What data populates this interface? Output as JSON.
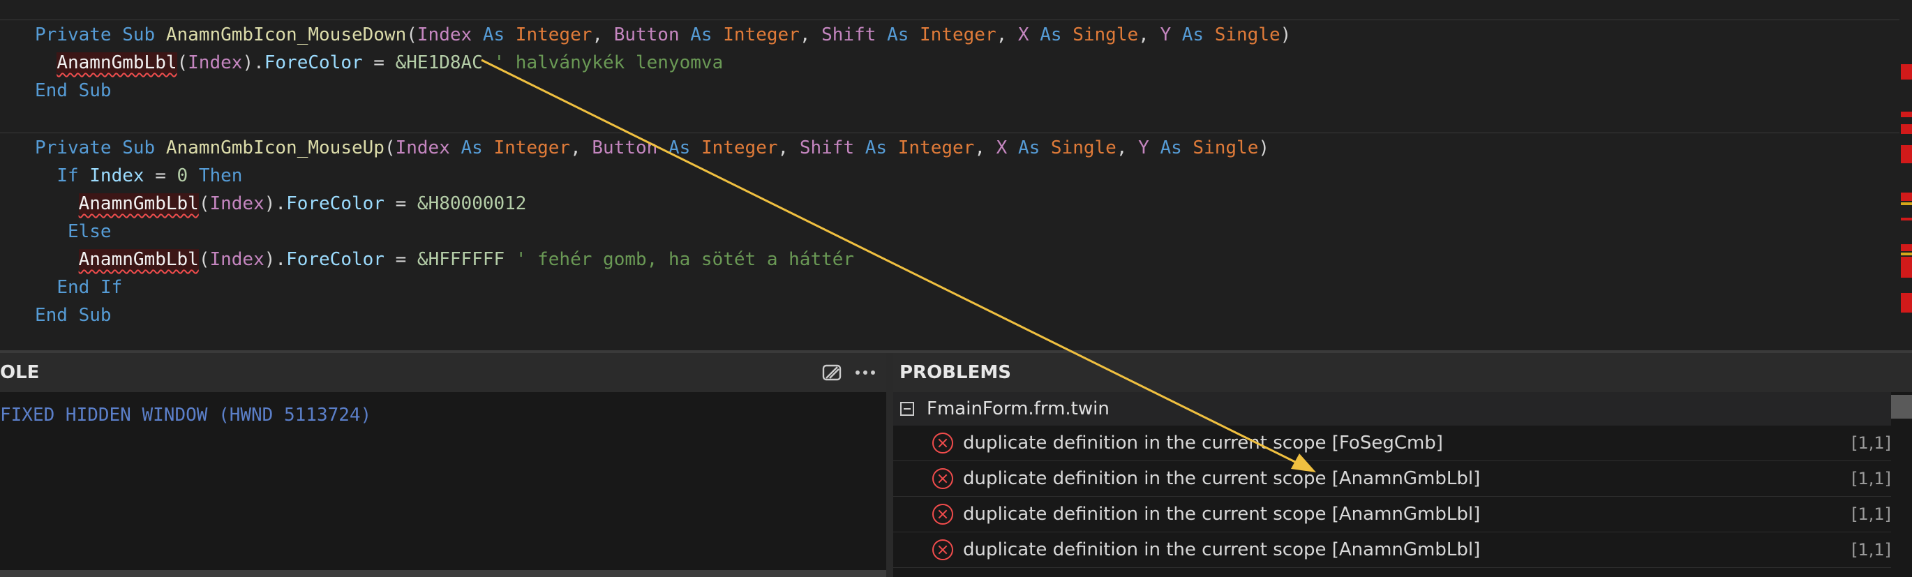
{
  "editor": {
    "sub1": {
      "kw_private": "Private",
      "kw_sub": "Sub",
      "name": "AnamnGmbIcon_MouseDown",
      "p_index": "Index",
      "p_button": "Button",
      "p_shift": "Shift",
      "p_x": "X",
      "p_y": "Y",
      "kw_as": "As",
      "t_integer": "Integer",
      "t_single": "Single",
      "body_obj": "AnamnGmbLbl",
      "body_idx": "Index",
      "body_prop": "ForeColor",
      "body_val": "&HE1D8AC",
      "body_comment": "' halványkék lenyomva",
      "end": "End Sub"
    },
    "sub2": {
      "kw_private": "Private",
      "kw_sub": "Sub",
      "name": "AnamnGmbIcon_MouseUp",
      "p_index": "Index",
      "p_button": "Button",
      "p_shift": "Shift",
      "p_x": "X",
      "p_y": "Y",
      "kw_as": "As",
      "t_integer": "Integer",
      "t_single": "Single",
      "if_kw": "If",
      "if_var": "Index",
      "if_eq": "=",
      "if_zero": "0",
      "then_kw": "Then",
      "obj": "AnamnGmbLbl",
      "idx": "Index",
      "prop": "ForeColor",
      "val1": "&H80000012",
      "else_kw": "Else",
      "val2": "&HFFFFFF",
      "comment2": "' fehér gomb, ha sötét a háttér",
      "end_if": "End If",
      "end": "End Sub"
    }
  },
  "console": {
    "title": "OLE",
    "line": "FIXED HIDDEN WINDOW (HWND 5113724)",
    "icons": [
      "clear-icon",
      "more-icon"
    ]
  },
  "problems": {
    "title": "PROBLEMS",
    "file": "FmainForm.frm.twin",
    "items": [
      {
        "message": "duplicate definition in the current scope [FoSegCmb]",
        "position": "[1,1]"
      },
      {
        "message": "duplicate definition in the current scope [AnamnGmbLbl]",
        "position": "[1,1]"
      },
      {
        "message": "duplicate definition in the current scope [AnamnGmbLbl]",
        "position": "[1,1]"
      },
      {
        "message": "duplicate definition in the current scope [AnamnGmbLbl]",
        "position": "[1,1]"
      }
    ]
  },
  "colors": {
    "error": "#f14c4c",
    "arrow": "#f0c040",
    "keyword": "#569cd6",
    "type": "#e07b39"
  }
}
